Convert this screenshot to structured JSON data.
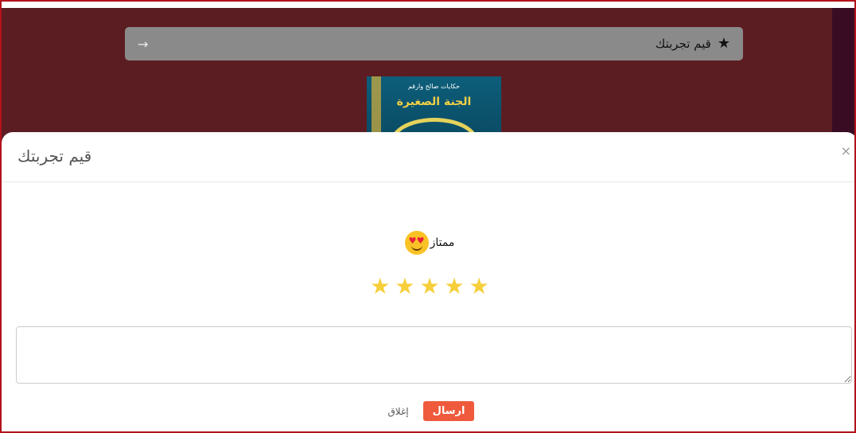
{
  "top_bar": {
    "title": "قيم تجربتك",
    "star_icon": "star-icon",
    "arrow_icon": "arrow-right-icon"
  },
  "book": {
    "subtitle": "حكايات صالح وارقم",
    "title": "الجنة الصغيرة"
  },
  "modal": {
    "title": "قيم تجربتك",
    "close_symbol": "×",
    "rating_text": "ممتاز",
    "rating_emoji": "heart-eyes-emoji-icon",
    "stars_filled": 5,
    "stars_total": 5,
    "comment_value": "",
    "send_label": "ارسال",
    "close_label": "إغلاق"
  },
  "colors": {
    "background": "#5c1d22",
    "accent": "#ef5a3c",
    "star": "#f6cf3a",
    "frame_border": "#b3121b"
  }
}
